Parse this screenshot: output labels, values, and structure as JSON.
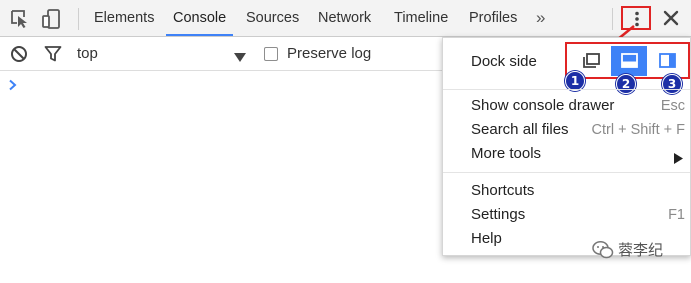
{
  "tabbar": {
    "icons": [
      "inspect-element-icon",
      "device-mode-icon"
    ],
    "tabs": [
      {
        "label": "Elements",
        "active": false
      },
      {
        "label": "Console",
        "active": true
      },
      {
        "label": "Sources",
        "active": false
      },
      {
        "label": "Network",
        "active": false
      },
      {
        "label": "Timeline",
        "active": false
      },
      {
        "label": "Profiles",
        "active": false
      }
    ],
    "more_tabs": "»",
    "menu_icon": "vertical-dots-icon",
    "close_icon": "close-icon"
  },
  "toolbar": {
    "clear_icon": "clear-console-icon",
    "filter_icon": "filter-icon",
    "context": "top",
    "preserve_log": {
      "label": "Preserve log",
      "checked": false
    }
  },
  "console": {
    "prompt_icon": "prompt-chevron-icon"
  },
  "menu": {
    "dock_side": {
      "label": "Dock side",
      "options": [
        {
          "icon": "undock-window-icon",
          "badge": "1",
          "selected": false
        },
        {
          "icon": "dock-bottom-icon",
          "badge": "2",
          "selected": true
        },
        {
          "icon": "dock-right-icon",
          "badge": "3",
          "selected": false
        }
      ]
    },
    "items": [
      {
        "label": "Show console drawer",
        "shortcut": "Esc"
      },
      {
        "label": "Search all files",
        "shortcut": "Ctrl + Shift + F"
      },
      {
        "label": "More tools",
        "submenu": true
      }
    ],
    "items2": [
      {
        "label": "Shortcuts",
        "shortcut": ""
      },
      {
        "label": "Settings",
        "shortcut": "F1"
      },
      {
        "label": "Help",
        "shortcut": ""
      }
    ]
  },
  "colors": {
    "accent": "#3e82f7",
    "highlight_box": "#e02424",
    "badge": "#1c2fa6"
  },
  "watermark": {
    "text": "蓉李纪"
  }
}
